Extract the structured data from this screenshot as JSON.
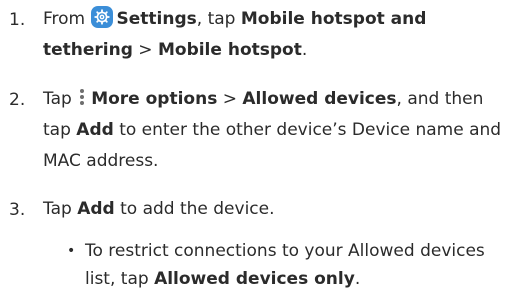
{
  "steps": [
    {
      "number": "1.",
      "prefix": "From",
      "settings": "Settings",
      "comma": ", tap",
      "hotspot_tethering": "Mobile hotspot and tethering",
      "sep": " > ",
      "mobile_hotspot": "Mobile hotspot",
      "end": "."
    },
    {
      "number": "2.",
      "tap": "Tap",
      "more_options": "More options",
      "sep": " > ",
      "allowed_devices": "Allowed devices",
      "middle": ", and then tap",
      "add": "Add",
      "tail": "to enter the other device’s Device name and MAC address."
    },
    {
      "number": "3.",
      "tap": "Tap",
      "add": "Add",
      "tail": "to add the device."
    }
  ],
  "sub_bullet": {
    "bullet": "•",
    "text": "To restrict connections to your Allowed devices list, tap",
    "allowed_only": "Allowed devices only",
    "end": "."
  },
  "icons": {
    "settings": "gear-icon",
    "more_options": "more-options-icon"
  },
  "colors": {
    "settings_icon": "#3b8ed8",
    "text": "#2b2b2b"
  }
}
